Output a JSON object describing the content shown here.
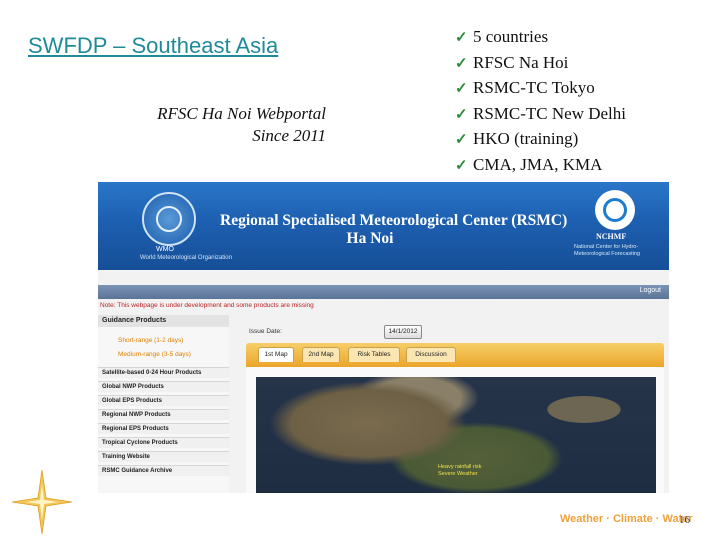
{
  "slide": {
    "title": "SWFDP – Southeast Asia",
    "subtitle_line1": "RFSC Ha Noi Webportal",
    "subtitle_line2": "Since 2011",
    "checklist": [
      "5 countries",
      "RFSC Na Hoi",
      "RSMC-TC Tokyo",
      "RSMC-TC New Delhi",
      "HKO (training)",
      "CMA, JMA, KMA"
    ],
    "check_icon": "check-mark",
    "footer_brand": "Weather · Climate · Water",
    "page_number": "16",
    "accent_color": "#1f8a9a"
  },
  "portal": {
    "banner_line1": "Regional Specialised Meteorological Center (RSMC)",
    "banner_line2": "Ha Noi",
    "wmo_label": "WMO",
    "wmo_sub": "World Meteorological Organization",
    "nchm_label": "NCHMF",
    "nchm_sub1": "National Center for Hydro-",
    "nchm_sub2": "Meteorological Forecasting",
    "logout_label": "Logout",
    "notice": "Note: This webpage is under development and some products are missing",
    "sidebar": {
      "header": "Guidance Products",
      "sub_items": [
        "Short-range (1-2 days)",
        "Medium-range (3-5 days)"
      ],
      "items": [
        "Satellite-based 0-24 Hour Products",
        "Global NWP Products",
        "Global EPS Products",
        "Regional NWP Products",
        "Regional EPS Products",
        "Tropical Cyclone Products",
        "Training Website",
        "RSMC Guidance Archive"
      ]
    },
    "issue_label": "Issue Date:",
    "issue_button": "14/1/2012",
    "tabs": [
      "1st Map",
      "2nd Map",
      "Risk Tables",
      "Discussion"
    ],
    "map_label_line1": "Heavy rainfall risk",
    "map_label_line2": "Severe Weather"
  }
}
